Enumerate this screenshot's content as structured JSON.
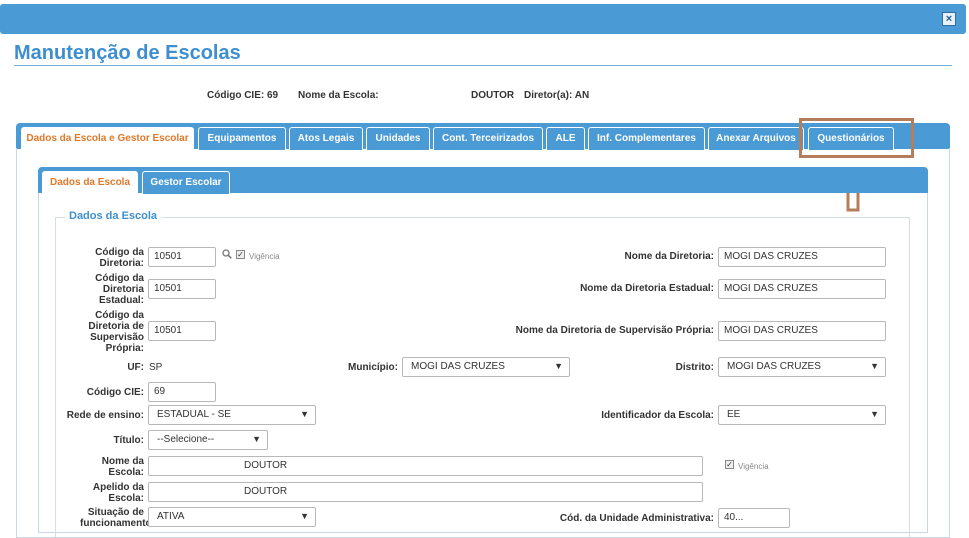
{
  "window": {
    "close_label": "×"
  },
  "page": {
    "title": "Manutenção de Escolas"
  },
  "info": {
    "codigo_cie_label": "Código CIE: 69",
    "nome_escola_label": "Nome da Escola:",
    "nome_escola_value": "DOUTOR",
    "diretor_label": "Diretor(a): AN"
  },
  "tabs": [
    {
      "label": "Dados da Escola e Gestor Escolar"
    },
    {
      "label": "Equipamentos"
    },
    {
      "label": "Atos Legais"
    },
    {
      "label": "Unidades"
    },
    {
      "label": "Cont. Terceirizados"
    },
    {
      "label": "ALE"
    },
    {
      "label": "Inf. Complementares"
    },
    {
      "label": "Anexar Arquivos"
    },
    {
      "label": "Questionários"
    }
  ],
  "subtabs": [
    {
      "label": "Dados da Escola"
    },
    {
      "label": "Gestor Escolar"
    }
  ],
  "section": {
    "legend": "Dados da Escola"
  },
  "form": {
    "codigo_diretoria": {
      "label": "Código da Diretoria:",
      "value": "10501",
      "vigencia": "Vigência"
    },
    "nome_diretoria": {
      "label": "Nome da Diretoria:",
      "value": "MOGI DAS CRUZES"
    },
    "codigo_diretoria_estadual": {
      "label": "Código da Diretoria Estadual:",
      "value": "10501"
    },
    "nome_diretoria_estadual": {
      "label": "Nome da Diretoria Estadual:",
      "value": "MOGI DAS CRUZES"
    },
    "codigo_diretoria_supervisao": {
      "label": "Código da Diretoria de Supervisão Própria:",
      "value": "10501"
    },
    "nome_diretoria_supervisao": {
      "label": "Nome da Diretoria de Supervisão Própria:",
      "value": "MOGI DAS CRUZES"
    },
    "uf": {
      "label": "UF:",
      "value": "SP"
    },
    "municipio": {
      "label": "Município:",
      "value": "MOGI DAS CRUZES"
    },
    "distrito": {
      "label": "Distrito:",
      "value": "MOGI DAS CRUZES"
    },
    "codigo_cie": {
      "label": "Código CIE:",
      "value": "69"
    },
    "rede_ensino": {
      "label": "Rede de ensino:",
      "value": "ESTADUAL - SE"
    },
    "identificador": {
      "label": "Identificador da Escola:",
      "value": "EE"
    },
    "titulo": {
      "label": "Título:",
      "value": "--Selecione--"
    },
    "nome_escola": {
      "label": "Nome da Escola:",
      "value": "DOUTOR",
      "vigencia": "Vigência"
    },
    "apelido_escola": {
      "label": "Apelido da Escola:",
      "value": "DOUTOR"
    },
    "situacao": {
      "label": "Situação de funcionamento:",
      "value": "ATIVA"
    },
    "cod_unidade_adm": {
      "label": "Cód. da Unidade Administrativa:",
      "value": "40..."
    }
  }
}
